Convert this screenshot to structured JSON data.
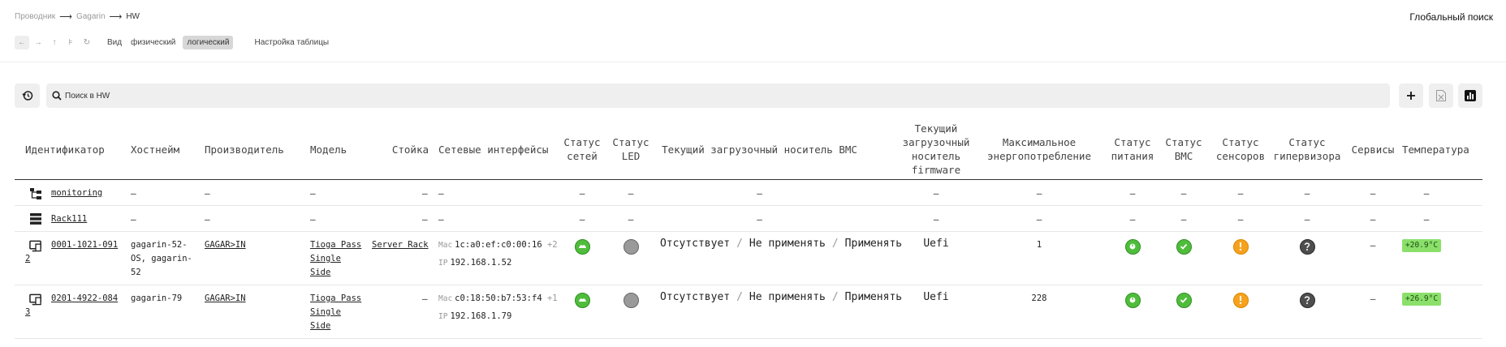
{
  "breadcrumb": {
    "items": [
      "Проводник",
      "Gagarin",
      "HW"
    ]
  },
  "header": {
    "global_search": "Глобальный поиск"
  },
  "toolbar": {
    "back": "←",
    "forward": "→",
    "up": "↑",
    "tree": "⊧",
    "refresh": "↻",
    "view_label": "Вид",
    "view_physical": "физический",
    "view_logical": "логический",
    "table_settings": "Настройка таблицы"
  },
  "search": {
    "placeholder": "Поиск в HW"
  },
  "table": {
    "headers": {
      "id": "Идентификатор",
      "hostname": "Хостнейм",
      "vendor": "Производитель",
      "model": "Модель",
      "rack": "Стойка",
      "net": "Сетевые интерфейсы",
      "net_status": "Статус сетей",
      "led_status": "Статус LED",
      "boot_bmc": "Текущий загрузочный носитель BMC",
      "boot_fw": "Текущий загрузочный носитель firmware",
      "max_power": "Максимальное энергопотребление",
      "power_status": "Статус питания",
      "bmc_status": "Статус BMC",
      "sensor_status": "Статус сенсоров",
      "hv_status": "Статус гипервизора",
      "services": "Сервисы",
      "temp": "Температура"
    },
    "rows": [
      {
        "icon": "hierarchy-icon",
        "id": "monitoring",
        "hostname": "–",
        "vendor": "–",
        "model": "–",
        "rack": "–",
        "net": "–",
        "net_status": "–",
        "led_status": "–",
        "boot_bmc": "–",
        "boot_fw": "–",
        "max_power": "–",
        "power_status": "–",
        "bmc_status": "–",
        "sensor_status": "–",
        "hv_status": "–",
        "services": "–",
        "temp": "–"
      },
      {
        "icon": "rack-icon",
        "id": "Rack111",
        "hostname": "–",
        "vendor": "–",
        "model": "–",
        "rack": "–",
        "net": "–",
        "net_status": "–",
        "led_status": "–",
        "boot_bmc": "–",
        "boot_fw": "–",
        "max_power": "–",
        "power_status": "–",
        "bmc_status": "–",
        "sensor_status": "–",
        "hv_status": "–",
        "services": "–",
        "temp": "–"
      },
      {
        "icon": "server-icon",
        "id_line1": "0001-1021-091",
        "id_line2": "2",
        "hostname_l1": "gagarin-52-",
        "hostname_l2": "OS, gagarin-",
        "hostname_l3": "52",
        "vendor": "GAGAR>IN",
        "model_l1": "Tioga Pass",
        "model_l2": "Single",
        "model_l3": "Side",
        "rack": "Server Rack",
        "mac_prefix": "Mac",
        "mac": "1c:a0:ef:c0:00:16",
        "mac_more": "+2",
        "ip_prefix": "IP",
        "ip": "192.168.1.52",
        "boot_absent": "Отсутствует",
        "boot_sep": "/",
        "boot_noapply": "Не применять",
        "boot_apply": "Применять",
        "boot_fw": "Uefi",
        "max_power": "1",
        "services": "–",
        "temp": "+20.9°C"
      },
      {
        "icon": "server-icon",
        "id_line1": "0201-4922-084",
        "id_line2": "3",
        "hostname_l1": "gagarin-79",
        "vendor": "GAGAR>IN",
        "model_l1": "Tioga Pass",
        "model_l2": "Single",
        "model_l3": "Side",
        "rack": "–",
        "mac_prefix": "Mac",
        "mac": "c0:18:50:b7:53:f4",
        "mac_more": "+1",
        "ip_prefix": "IP",
        "ip": "192.168.1.79",
        "boot_absent": "Отсутствует",
        "boot_sep": "/",
        "boot_noapply": "Не применять",
        "boot_apply": "Применять",
        "boot_fw": "Uefi",
        "max_power": "228",
        "services": "–",
        "temp": "+26.9°C"
      }
    ]
  },
  "colors": {
    "ok": "#4fbd3b",
    "warn": "#f6a21e",
    "unknown": "#4e4e4e",
    "off": "#9a9a9a",
    "temp_bg": "#8be06b"
  }
}
